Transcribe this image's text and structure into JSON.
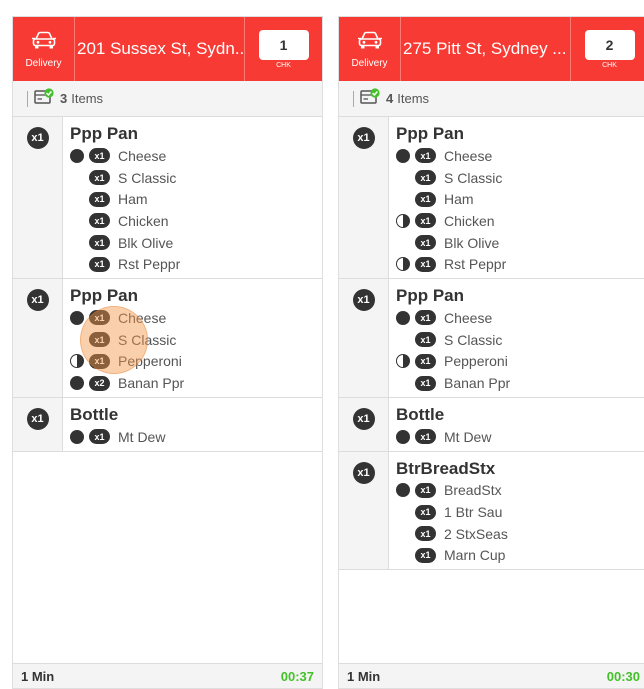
{
  "tickets": [
    {
      "mode_label": "Delivery",
      "address": "201 Sussex St, Sydn...",
      "check_number": "1",
      "check_label": "CHK",
      "item_count": "3",
      "items_label": "Items",
      "items": [
        {
          "qty": "x1",
          "name": "Ppp Pan",
          "mods": [
            {
              "ind": "whole",
              "qty": "x1",
              "name": "Cheese"
            },
            {
              "ind": "none",
              "qty": "x1",
              "name": "S Classic"
            },
            {
              "ind": "none",
              "qty": "x1",
              "name": "Ham"
            },
            {
              "ind": "none",
              "qty": "x1",
              "name": "Chicken"
            },
            {
              "ind": "none",
              "qty": "x1",
              "name": "Blk Olive"
            },
            {
              "ind": "none",
              "qty": "x1",
              "name": "Rst Peppr"
            }
          ]
        },
        {
          "qty": "x1",
          "name": "Ppp Pan",
          "mods": [
            {
              "ind": "whole",
              "qty": "x1",
              "name": "Cheese"
            },
            {
              "ind": "none",
              "qty": "x1",
              "name": "S Classic"
            },
            {
              "ind": "half",
              "qty": "x1",
              "name": "Pepperoni"
            },
            {
              "ind": "whole",
              "qty": "x2",
              "name": "Banan Ppr"
            }
          ]
        },
        {
          "qty": "x1",
          "name": "Bottle",
          "mods": [
            {
              "ind": "whole",
              "qty": "x1",
              "name": "Mt Dew"
            }
          ]
        }
      ],
      "elapsed": "1 Min",
      "timer": "00:37"
    },
    {
      "mode_label": "Delivery",
      "address": "275 Pitt St, Sydney ...",
      "check_number": "2",
      "check_label": "CHK",
      "item_count": "4",
      "items_label": "Items",
      "items": [
        {
          "qty": "x1",
          "name": "Ppp Pan",
          "mods": [
            {
              "ind": "whole",
              "qty": "x1",
              "name": "Cheese"
            },
            {
              "ind": "none",
              "qty": "x1",
              "name": "S Classic"
            },
            {
              "ind": "none",
              "qty": "x1",
              "name": "Ham"
            },
            {
              "ind": "half",
              "qty": "x1",
              "name": "Chicken"
            },
            {
              "ind": "none",
              "qty": "x1",
              "name": "Blk Olive"
            },
            {
              "ind": "half",
              "qty": "x1",
              "name": "Rst Peppr"
            }
          ]
        },
        {
          "qty": "x1",
          "name": "Ppp Pan",
          "mods": [
            {
              "ind": "whole",
              "qty": "x1",
              "name": "Cheese"
            },
            {
              "ind": "none",
              "qty": "x1",
              "name": "S Classic"
            },
            {
              "ind": "half",
              "qty": "x1",
              "name": "Pepperoni"
            },
            {
              "ind": "none",
              "qty": "x1",
              "name": "Banan Ppr"
            }
          ]
        },
        {
          "qty": "x1",
          "name": "Bottle",
          "mods": [
            {
              "ind": "whole",
              "qty": "x1",
              "name": "Mt Dew"
            }
          ]
        },
        {
          "qty": "x1",
          "name": "BtrBreadStx",
          "mods": [
            {
              "ind": "whole",
              "qty": "x1",
              "name": "BreadStx"
            },
            {
              "ind": "none",
              "qty": "x1",
              "name": "1 Btr Sau"
            },
            {
              "ind": "none",
              "qty": "x1",
              "name": "2 StxSeas"
            },
            {
              "ind": "none",
              "qty": "x1",
              "name": "Marn Cup"
            }
          ]
        }
      ],
      "elapsed": "1 Min",
      "timer": "00:30"
    }
  ],
  "colors": {
    "header": "#f73a33",
    "timer": "#44c02a",
    "badge": "#333333"
  },
  "icons": {
    "mode": "car-icon",
    "items_bar": "bumped-check-icon"
  }
}
